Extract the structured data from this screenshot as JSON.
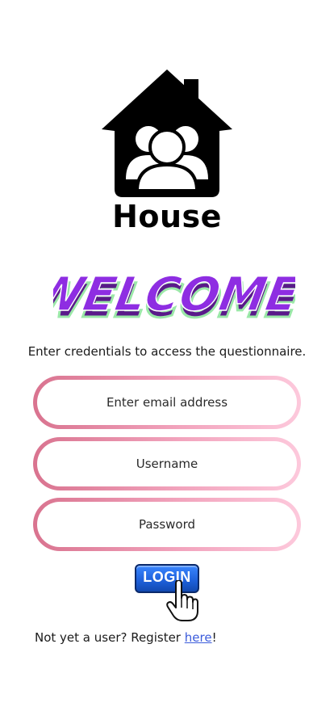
{
  "brand": {
    "name": "House",
    "logo_icon": "house-users-icon"
  },
  "hero": {
    "welcome_text": "WELCOME!"
  },
  "instructions": "Enter credentials to access the questionnaire.",
  "form": {
    "email_placeholder": "Enter email address",
    "username_placeholder": "Username",
    "password_placeholder": "Password",
    "login_label": "LOGIN"
  },
  "register": {
    "prefix": "Not yet a user? Register ",
    "link_text": "here",
    "suffix": "!"
  },
  "colors": {
    "welcome_fill": "#8e2de2",
    "welcome_outline": "#9be8a8",
    "field_gradient_start": "#d9738f",
    "field_gradient_end": "#fdc9dc",
    "login_blue": "#1d5fd8",
    "link_blue": "#3b5bdb"
  }
}
